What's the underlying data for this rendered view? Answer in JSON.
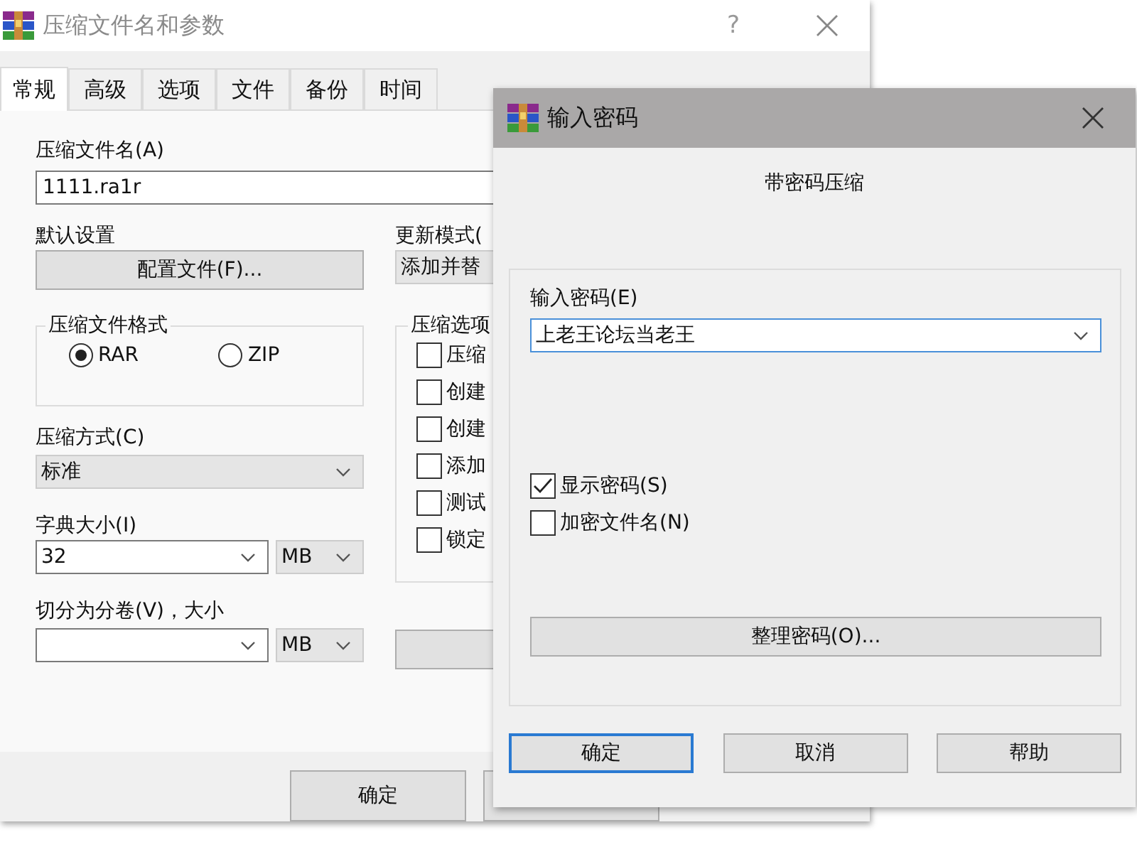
{
  "main_window": {
    "title": "压缩文件名和参数",
    "help": "?",
    "tabs": [
      {
        "label": "常规",
        "selected": true
      },
      {
        "label": "高级",
        "selected": false
      },
      {
        "label": "选项",
        "selected": false
      },
      {
        "label": "文件",
        "selected": false
      },
      {
        "label": "备份",
        "selected": false
      },
      {
        "label": "时间",
        "selected": false
      }
    ],
    "archive_name_label": "压缩文件名(A)",
    "archive_name": "1111.ra1r",
    "profile_label": "默认设置",
    "profile_button": "配置文件(F)...",
    "update_mode_label": "更新模式(",
    "update_mode": "添加并替",
    "format_group": {
      "title": "压缩文件格式",
      "options": [
        {
          "label": "RAR",
          "selected": true
        },
        {
          "label": "ZIP",
          "selected": false
        }
      ]
    },
    "method_label": "压缩方式(C)",
    "method": "标准",
    "dict_label": "字典大小(I)",
    "dict_size": "32",
    "dict_unit": "MB",
    "split_label": "切分为分卷(V)，大小",
    "split_unit": "MB",
    "options_group": {
      "title": "压缩选项",
      "items": [
        {
          "label": "压缩",
          "checked": false
        },
        {
          "label": "创建",
          "checked": false
        },
        {
          "label": "创建",
          "checked": false
        },
        {
          "label": "添加",
          "checked": false
        },
        {
          "label": "测试",
          "checked": false
        },
        {
          "label": "锁定",
          "checked": false
        }
      ]
    },
    "ok_button": "确定"
  },
  "password_dialog": {
    "title": "输入密码",
    "heading": "带密码压缩",
    "password_label": "输入密码(E)",
    "password": "上老王论坛当老王",
    "options": [
      {
        "label": "显示密码(S)",
        "checked": true
      },
      {
        "label": "加密文件名(N)",
        "checked": false
      }
    ],
    "organize_button": "整理密码(O)...",
    "buttons": [
      {
        "label": "确定",
        "default": true
      },
      {
        "label": "取消",
        "default": false
      },
      {
        "label": "帮助",
        "default": false
      }
    ]
  }
}
